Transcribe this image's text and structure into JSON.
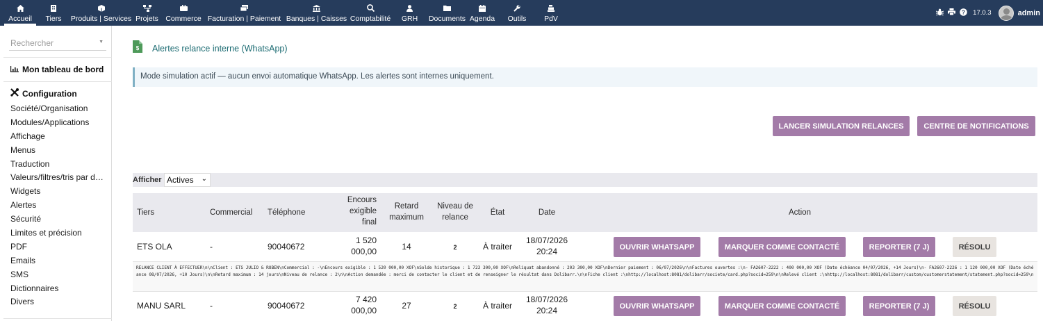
{
  "topmenu": [
    {
      "label": "Accueil",
      "icon": "home-icon"
    },
    {
      "label": "Tiers",
      "icon": "building-icon"
    },
    {
      "label": "Produits | Services",
      "icon": "cube-icon"
    },
    {
      "label": "Projets",
      "icon": "sitemap-icon"
    },
    {
      "label": "Commerce",
      "icon": "briefcase-icon"
    },
    {
      "label": "Facturation | Paiement",
      "icon": "money-icon"
    },
    {
      "label": "Banques | Caisses",
      "icon": "bank-icon"
    },
    {
      "label": "Comptabilité",
      "icon": "search-dollar-icon"
    },
    {
      "label": "GRH",
      "icon": "user-icon"
    },
    {
      "label": "Documents",
      "icon": "folder-icon"
    },
    {
      "label": "Agenda",
      "icon": "calendar-icon"
    },
    {
      "label": "Outils",
      "icon": "wrench-icon"
    },
    {
      "label": "PdV",
      "icon": "cash-register-icon"
    }
  ],
  "topright": {
    "version": "17.0.3",
    "user": "admin"
  },
  "sidebar": {
    "search_placeholder": "Rechercher",
    "dashboard": "Mon tableau de bord",
    "config_title": "Configuration",
    "items": [
      "Société/Organisation",
      "Modules/Applications",
      "Affichage",
      "Menus",
      "Traduction",
      "Valeurs/filtres/tris par déf…",
      "Widgets",
      "Alertes",
      "Sécurité",
      "Limites et précision",
      "PDF",
      "Emails",
      "SMS",
      "Dictionnaires",
      "Divers"
    ]
  },
  "page": {
    "title": "Alertes relance interne (WhatsApp)",
    "info": "Mode simulation actif — aucun envoi automatique WhatsApp. Les alertes sont internes uniquement.",
    "btn_simulation": "LANCER SIMULATION RELANCES",
    "btn_notifications": "CENTRE DE NOTIFICATIONS",
    "filter_label": "Afficher",
    "filter_value": "Actives"
  },
  "table": {
    "headers": {
      "tiers": "Tiers",
      "commercial": "Commercial",
      "telephone": "Téléphone",
      "encours1": "Encours",
      "encours2": "exigible",
      "encours3": "final",
      "retard1": "Retard",
      "retard2": "maximum",
      "niveau1": "Niveau de",
      "niveau2": "relance",
      "etat": "État",
      "date": "Date",
      "action": "Action"
    },
    "actions": {
      "whatsapp": "OUVRIR WHATSAPP",
      "contacte": "MARQUER COMME CONTACTÉ",
      "reporter": "REPORTER (7 J)",
      "resolu": "RÉSOLU"
    },
    "rows": [
      {
        "tiers": "ETS OLA",
        "commercial": "-",
        "telephone": "90040672",
        "encours1": "1 520",
        "encours2": "000,00",
        "retard": "14",
        "niveau": "2",
        "etat": "À traiter",
        "date1": "18/07/2026",
        "date2": "20:24"
      },
      {
        "tiers": "MANU SARL",
        "commercial": "-",
        "telephone": "90040672",
        "encours1": "7 420",
        "encours2": "000,00",
        "retard": "27",
        "niveau": "2",
        "etat": "À traiter",
        "date1": "18/07/2026",
        "date2": "20:24"
      }
    ],
    "note": "RELANCE CLIENT À EFFECTUER\\n\\nClient : ETS JULIO & RUBEN\\nCommercial : -\\nEncours exigible : 1 520 000,00 XOF\\nSolde historique : 1 723 300,00 XOF\\nReliquat abandonné : 203 300,00 XOF\\nDernier paiement : 06/07/2026\\n\\nFactures ouvertes :\\n- FA2607-2222 : 400 000,00 XOF (Date échéance 04/07/2026, +14 Jours)\\n- FA2607-2226 : 1 120 000,00 XOF (Date échéance 08/07/2026, +10 Jours)\\n\\nRetard maximum : 14 jours\\nNiveau de relance : 2\\n\\nAction demandée : merci de contacter le client et de renseigner le résultat dans Dolibarr.\\n\\nFiche client :\\nhttp://localhost:8081/dolibarr/societe/card.php?socid=259\\n\\nRelevé client :\\nhttp://localhost:8081/dolibarr/custom/customerstatement/statement.php?socid=259\\n"
  }
}
